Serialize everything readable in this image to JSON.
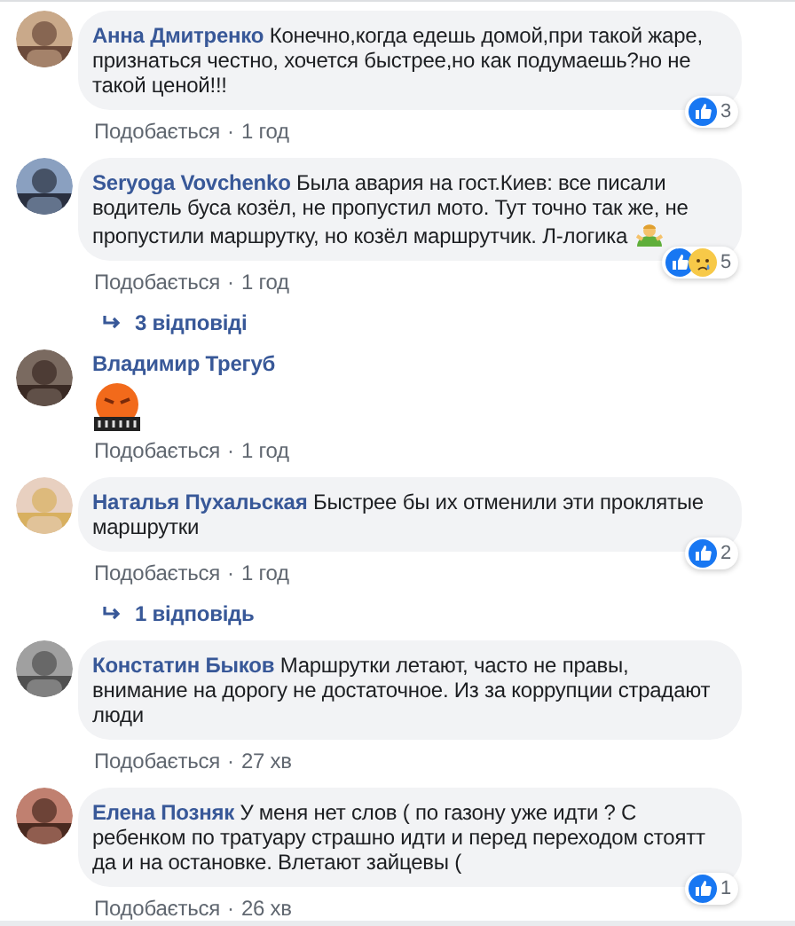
{
  "comments": [
    {
      "kind": "text",
      "author": "Анна Дмитренко",
      "text": "Конечно,когда едешь домой,при такой жаре, признаться честно, хочется быстрее,но как подумаешь?но не такой ценой!!!",
      "like_label": "Подобається",
      "dot": "·",
      "time": "1 год",
      "reactions": [
        {
          "kind": "like"
        }
      ],
      "reaction_count": "3"
    },
    {
      "kind": "text_emoji",
      "author": "Seryoga Vovchenko",
      "text": "Была авария на гост.Киев: все писали водитель буса козёл, не пропустил мото. Тут точно так же, не пропустили маршрутку, но козёл маршрутчик. Л-логика",
      "like_label": "Подобається",
      "dot": "·",
      "time": "1 год",
      "reactions": [
        {
          "kind": "like"
        },
        {
          "kind": "sad"
        }
      ],
      "reaction_count": "5",
      "replies": "3 відповіді"
    },
    {
      "kind": "sticker",
      "author": "Владимир Трегуб",
      "like_label": "Подобається",
      "dot": "·",
      "time": "1 год"
    },
    {
      "kind": "text",
      "author": "Наталья Пухальская",
      "text": "Быстрее бы их отменили эти проклятые маршрутки",
      "like_label": "Подобається",
      "dot": "·",
      "time": "1 год",
      "reactions": [
        {
          "kind": "like"
        }
      ],
      "reaction_count": "2",
      "replies": "1 відповідь"
    },
    {
      "kind": "text",
      "author": "Констатин Быков",
      "text": "Маршрутки летают, часто не правы, внимание на дорогу не достаточное. Из за коррупции страдают люди",
      "like_label": "Подобається",
      "dot": "·",
      "time": "27 хв"
    },
    {
      "kind": "text",
      "author": "Елена Позняк",
      "text": "У меня нет слов ( по газону уже идти ? С ребенком по тратуару страшно идти и перед переходом стоятт да и на остановке. Влетают зайцевы (",
      "like_label": "Подобається",
      "dot": "·",
      "time": "26 хв",
      "reactions": [
        {
          "kind": "like"
        }
      ],
      "reaction_count": "1"
    }
  ]
}
